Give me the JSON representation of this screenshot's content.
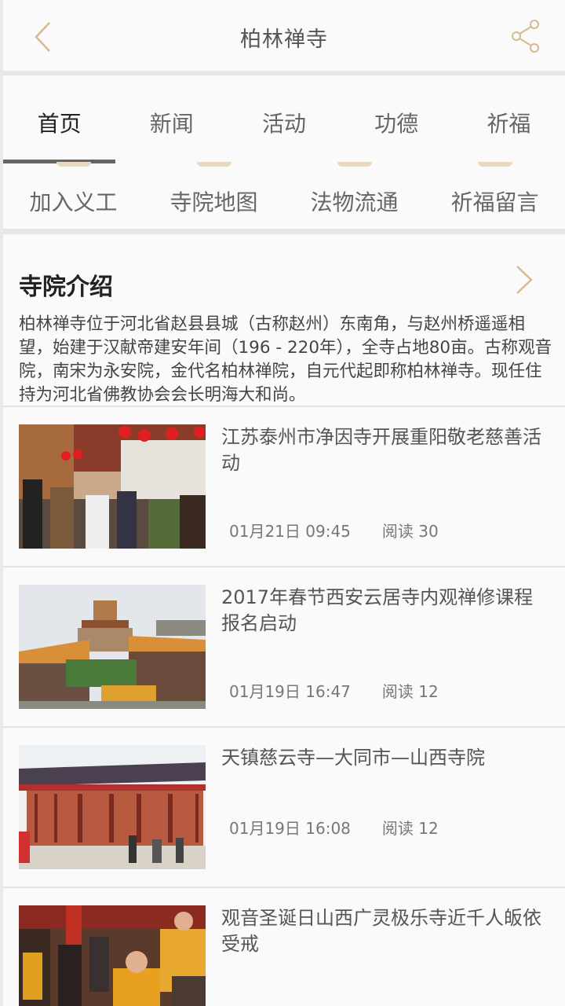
{
  "header": {
    "title": "柏林禅寺"
  },
  "tabs": [
    {
      "label": "首页",
      "active": true
    },
    {
      "label": "新闻"
    },
    {
      "label": "活动"
    },
    {
      "label": "功德"
    },
    {
      "label": "祈福"
    }
  ],
  "quick_links": [
    {
      "label": "加入义工"
    },
    {
      "label": "寺院地图"
    },
    {
      "label": "法物流通"
    },
    {
      "label": "祈福留言"
    }
  ],
  "intro": {
    "heading": "寺院介绍",
    "text": "柏林禅寺位于河北省赵县县城（古称赵州）东南角，与赵州桥遥遥相望，始建于汉献帝建安年间（196 - 220年），全寺占地80亩。古称观音院，南宋为永安院，金代名柏林禅院，自元代起即称柏林禅寺。现任住持为河北省佛教协会会长明海大和尚。"
  },
  "news": [
    {
      "title": "江苏泰州市净因寺开展重阳敬老慈善活动",
      "date": "01月21日 09:45",
      "reads": "阅读 30"
    },
    {
      "title": "2017年春节西安云居寺内观禅修课程报名启动",
      "date": "01月19日 16:47",
      "reads": "阅读 12"
    },
    {
      "title": "天镇慈云寺—大同市—山西寺院",
      "date": "01月19日 16:08",
      "reads": "阅读 12"
    },
    {
      "title": "观音圣诞日山西广灵极乐寺近千人皈依受戒",
      "date": "",
      "reads": ""
    }
  ],
  "colors": {
    "accent": "#d9b98f",
    "divider": "#e6e6e6"
  }
}
